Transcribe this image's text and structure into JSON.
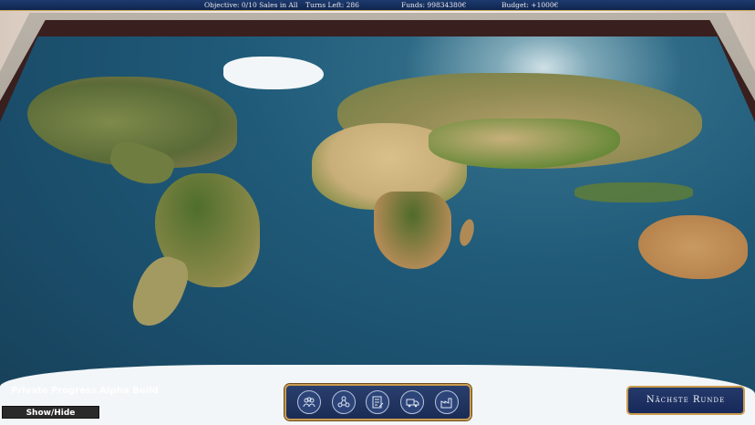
{
  "status_bar": {
    "objective": "Objective:  0/10 Sales in All",
    "turns_left": "Turns Left: 286",
    "funds": "Funds: 99834380€",
    "budget": "Budget: +1000€"
  },
  "hud": {
    "dev_label": "Private Progress Alpha Build",
    "show_hide_label": "Show/Hide",
    "next_round_label": "Nächste Runde"
  },
  "toolbar": {
    "buttons": [
      "people-icon",
      "network-icon",
      "document-edit-icon",
      "truck-icon",
      "factory-icon"
    ]
  },
  "colors": {
    "topbar": "#0f2550",
    "accent_gold": "#c99b4e",
    "ocean": "#1f5a78",
    "button_blue": "#24396a"
  }
}
